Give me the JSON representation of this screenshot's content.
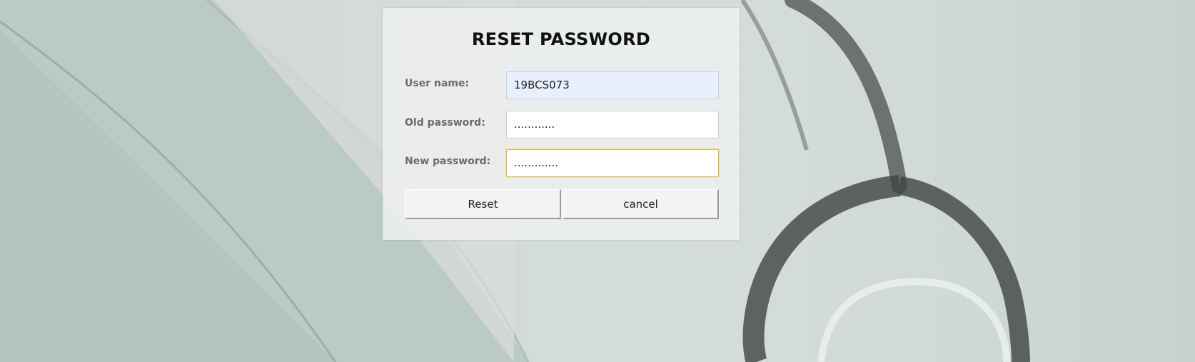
{
  "form": {
    "title": "RESET PASSWORD",
    "username_label": "User name:",
    "username_value": "19BCS073",
    "old_password_label": "Old password:",
    "old_password_value": "............",
    "new_password_label": "New password:",
    "new_password_value": ".............",
    "reset_label": "Reset",
    "cancel_label": "cancel"
  },
  "colors": {
    "focus_border": "#e9b43a",
    "autofill_bg": "#e8f0fe"
  }
}
